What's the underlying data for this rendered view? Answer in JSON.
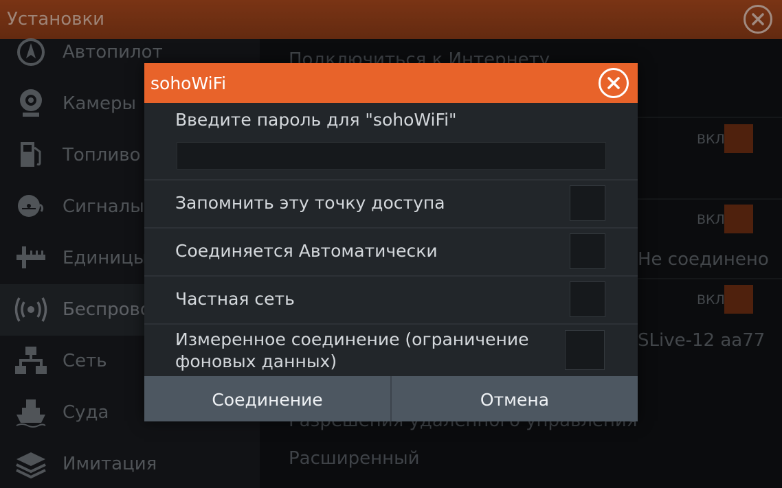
{
  "header": {
    "title": "Установки",
    "close_icon": "close-icon"
  },
  "sidebar": {
    "items": [
      {
        "label": "Автопилот",
        "icon": "autopilot-icon"
      },
      {
        "label": "Камеры",
        "icon": "camera-icon"
      },
      {
        "label": "Топливо",
        "icon": "fuel-icon"
      },
      {
        "label": "Сигналы",
        "icon": "alarm-bell-icon"
      },
      {
        "label": "Единицы",
        "icon": "units-ruler-icon"
      },
      {
        "label": "Беспрово",
        "icon": "wireless-icon"
      },
      {
        "label": "Сеть",
        "icon": "network-icon"
      },
      {
        "label": "Суда",
        "icon": "vessels-icon"
      },
      {
        "label": "Имитация",
        "icon": "simulation-layers-icon"
      }
    ],
    "active_index": 5
  },
  "main": {
    "connect_internet": "Подключиться к Интернету",
    "toggle_label": "ВКЛ",
    "status_not_connected": "Не соединено",
    "device_name": "SLive-12 aa77",
    "remote_control": "Разрешения удаленного управления",
    "advanced": "Расширенный"
  },
  "dialog": {
    "title": "sohoWiFi",
    "prompt": "Введите пароль для \"sohoWiFi\"",
    "password_value": "",
    "options": [
      {
        "label": "Запомнить эту точку доступа",
        "checked": false
      },
      {
        "label": "Соединяется Автоматически",
        "checked": false
      },
      {
        "label": "Частная сеть",
        "checked": false
      },
      {
        "label": "Измеренное соединение (ограничение фоновых данных)",
        "checked": false
      }
    ],
    "connect_label": "Соединение",
    "cancel_label": "Отмена"
  },
  "colors": {
    "accent_orange": "#e8632a",
    "titlebar_dim": "#6a2c12",
    "button_gray": "#4d5761"
  }
}
